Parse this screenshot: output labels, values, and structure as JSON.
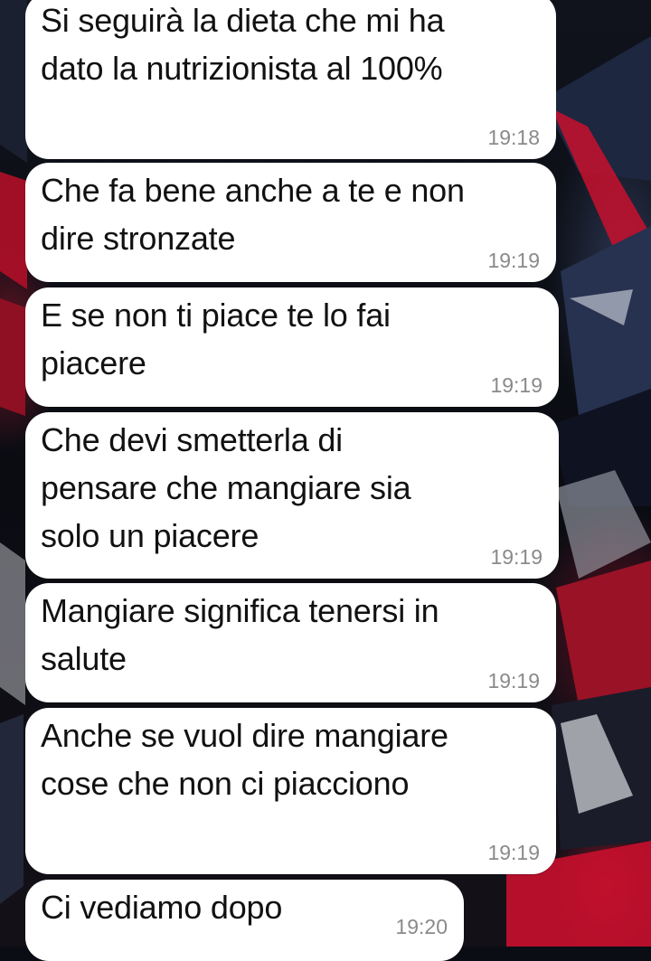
{
  "conversation": {
    "messages": [
      {
        "text": "Si seguirà la dieta che mi ha\ndato la nutrizionista al 100%",
        "time": "19:18"
      },
      {
        "text": "Che fa bene anche a te e non\ndire stronzate",
        "time": "19:19"
      },
      {
        "text": "E se non ti piace te lo fai\npiacere",
        "time": "19:19"
      },
      {
        "text": "Che devi smetterla di\npensare che mangiare sia\nsolo un piacere",
        "time": "19:19"
      },
      {
        "text": "Mangiare significa tenersi in\nsalute",
        "time": "19:19"
      },
      {
        "text": "Anche se vuol dire mangiare\ncose che non ci piacciono",
        "time": "19:19"
      },
      {
        "text": "Ci vediamo dopo",
        "time": "19:20"
      }
    ]
  },
  "theme": {
    "bubble_color": "#ffffff",
    "text_color": "#111111",
    "time_color": "#8a8a8a",
    "wallpaper_accent": "#c8102e"
  }
}
